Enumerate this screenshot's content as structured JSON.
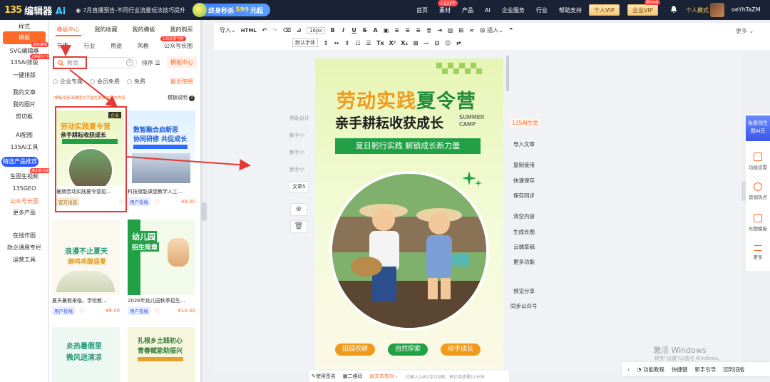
{
  "topbar": {
    "logo_mark": "135",
    "logo_text": "编辑器",
    "logo_ai": "Ai",
    "notice": "7月直播预告-不同行业流量玩法技巧提升",
    "promo_prefix": "终身秒杀",
    "promo_price": "599",
    "promo_suffix": "元起",
    "nav": [
      {
        "label": "首页",
        "badge": ""
      },
      {
        "label": "素材",
        "badge": "+137个"
      },
      {
        "label": "产品",
        "badge": ""
      },
      {
        "label": "AI",
        "badge": ""
      },
      {
        "label": "企业服务",
        "badge": ""
      },
      {
        "label": "行业",
        "badge": ""
      },
      {
        "label": "帮助支持",
        "badge": ""
      }
    ],
    "personal_vip": "个人VIP",
    "enterprise_vip": "企业VIP",
    "enterprise_badge": "限时4折",
    "user_mode": "个人模式",
    "username": "oeYhTaZM"
  },
  "sidebar": {
    "items": [
      {
        "label": "样式"
      },
      {
        "label": "模板",
        "active": true
      },
      {
        "label": "SVG编辑器",
        "badge": "超级编辑"
      },
      {
        "label": "135AI排版",
        "badge": "2排版5个月"
      },
      {
        "label": "一键排版"
      },
      {
        "label": "我的文章"
      },
      {
        "label": "我的图片"
      },
      {
        "label": "剪切板"
      },
      {
        "label": "AI配图"
      },
      {
        "label": "135AI工具"
      },
      {
        "label": "精选产品推荐",
        "highlight": true
      },
      {
        "label": "生图生视频",
        "badge": "推出新功能"
      },
      {
        "label": "135GEO"
      },
      {
        "label": "公众号长图",
        "orange": true
      },
      {
        "label": "更多产品"
      },
      {
        "label": "在线作图"
      },
      {
        "label": "政企通用专栏"
      },
      {
        "label": "运营工具"
      }
    ]
  },
  "panel": {
    "tabs1": [
      "模板中心",
      "我的收藏",
      "我的模板",
      "我的购买"
    ],
    "tabs2": [
      "节日",
      "行业",
      "用途",
      "风格",
      "公众号长图"
    ],
    "tab2_badge": "135会员可用",
    "search_value": "教育",
    "sort_label": "排序",
    "center_btn": "模板中心",
    "filters": [
      "企业专属",
      "会员免费",
      "免费"
    ],
    "recent": "最近使用",
    "hint": "*模板使用请确保文字图片更换为您的内容",
    "guide": "模板说明",
    "cards": [
      {
        "caption": "暑期劳动实践夏令营招...",
        "tag": "官方出品",
        "tag_type": "official",
        "price": "",
        "thumb_title": "劳动实践夏令营",
        "thumb_sub": "亲手耕耘收获成长",
        "thumb_badge": "企业"
      },
      {
        "caption": "科技赋能课堂教学人工...",
        "tag": "用户投稿",
        "tag_type": "user",
        "price": "¥9.00",
        "thumb_title": "数智融合启新思",
        "thumb_sub": "协同研修 共促成长",
        "thumb_badge": ""
      },
      {
        "caption": "夏天暑假来临，学校教...",
        "tag": "用户投稿",
        "tag_type": "user",
        "price": "¥9.00",
        "thumb_title": "浪漫不止夏天",
        "thumb_sub": "蝉鸣唤醒盛夏",
        "thumb_badge": ""
      },
      {
        "caption": "2026年幼儿园秋季招生...",
        "tag": "用户投稿",
        "tag_type": "user",
        "price": "¥10.00",
        "thumb_title": "幼儿园",
        "thumb_sub": "招生简章",
        "thumb_badge": ""
      },
      {
        "caption": "",
        "tag": "",
        "tag_type": "",
        "price": "",
        "thumb_title": "炎热暑假里",
        "thumb_sub": "微风送清凉",
        "thumb_badge": ""
      },
      {
        "caption": "",
        "tag": "",
        "tag_type": "",
        "price": "",
        "thumb_title": "扎根乡土践初心",
        "thumb_sub": "青春赋能助振兴",
        "thumb_badge": ""
      }
    ]
  },
  "toolbar": {
    "import": "导入",
    "html": "HTML",
    "font_size": "16px",
    "font_family": "默认字体",
    "insert": "插入",
    "more": "更多"
  },
  "editor": {
    "left_items": [
      "帮助设计",
      "新手小",
      "新手小",
      "新手小"
    ],
    "doc_label": "文章5",
    "ai_btn": "135AI生文",
    "actions": [
      "导入文章",
      "复制使用",
      "快速保存",
      "保存同步",
      "清空内容",
      "生成长图",
      "云端草稿",
      "更多功能",
      "预览分享",
      "同步公众号"
    ]
  },
  "poster": {
    "title_orange": "劳动实践",
    "title_green": "夏令营",
    "subtitle": "亲手耕耘收获成长",
    "camp_en_1": "SUMMER",
    "camp_en_2": "CAMP",
    "strip": "夏日躬行实践 解锁成长新力量",
    "pills": [
      "田园农耕",
      "自然探索",
      "动手成长"
    ]
  },
  "rightbar": {
    "promo": "免费领生图AI豆",
    "items": [
      "功能设置",
      "营销热点",
      "长图模板",
      "更多"
    ]
  },
  "bottombar": {
    "signature": "使用签名",
    "qrcode": "二维码",
    "proofread": "文本校对",
    "stat": "已输入1492字/29图，预计阅读需11分钟"
  },
  "bottom_right": [
    "功能教程",
    "快捷键",
    "新手引导",
    "回到旧版"
  ],
  "watermark": {
    "title": "激活 Windows",
    "sub": "转到\"设置\"以激活 Windows。"
  },
  "colors": {
    "accent": "#ff6a28",
    "topbar": "#1a2236",
    "green": "#22a045",
    "annotation": "#e53935"
  }
}
